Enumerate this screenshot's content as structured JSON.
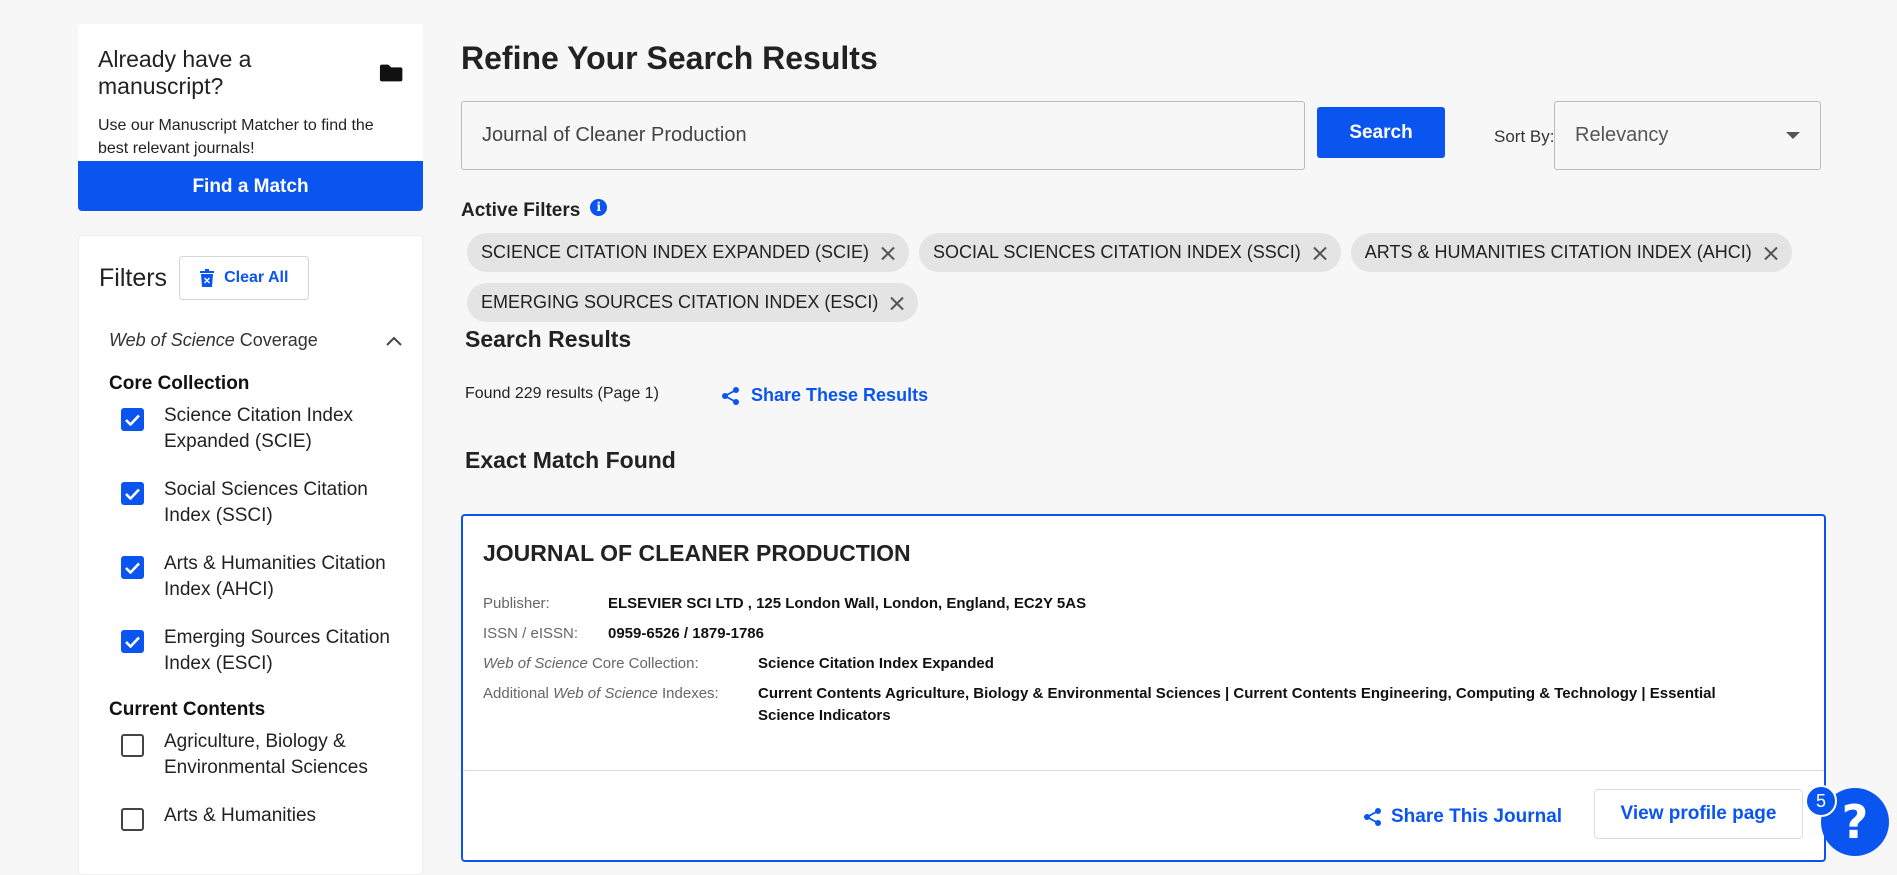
{
  "sidebar": {
    "manuscript": {
      "title": "Already have a manuscript?",
      "description": "Use our Manuscript Matcher to find the best relevant journals!",
      "button": "Find a Match"
    },
    "filters": {
      "title": "Filters",
      "clear_all": "Clear All",
      "coverage_italic": "Web of Science",
      "coverage_rest": " Coverage",
      "core_title": "Core Collection",
      "core_items": [
        {
          "label": "Science Citation Index Expanded (SCIE)",
          "checked": true
        },
        {
          "label": "Social Sciences Citation Index (SSCI)",
          "checked": true
        },
        {
          "label": "Arts & Humanities Citation Index (AHCI)",
          "checked": true
        },
        {
          "label": "Emerging Sources Citation Index (ESCI)",
          "checked": true
        }
      ],
      "current_title": "Current Contents",
      "current_items": [
        {
          "label": "Agriculture, Biology & Environmental Sciences",
          "checked": false
        },
        {
          "label": "Arts & Humanities",
          "checked": false
        }
      ]
    }
  },
  "main": {
    "title": "Refine Your Search Results",
    "search": {
      "value": "Journal of Cleaner Production",
      "button": "Search"
    },
    "sort": {
      "label": "Sort By:",
      "value": "Relevancy"
    },
    "active_filters": {
      "label": "Active Filters",
      "chips": [
        "SCIENCE CITATION INDEX EXPANDED (SCIE)",
        "SOCIAL SCIENCES CITATION INDEX (SSCI)",
        "ARTS & HUMANITIES CITATION INDEX (AHCI)",
        "EMERGING SOURCES CITATION INDEX (ESCI)"
      ]
    },
    "results": {
      "title": "Search Results",
      "count": "Found 229 results (Page 1)",
      "share": "Share These Results",
      "exact_title": "Exact Match Found"
    },
    "journal": {
      "title": "JOURNAL OF CLEANER PRODUCTION",
      "publisher_label": "Publisher:",
      "publisher": "ELSEVIER SCI LTD , 125 London Wall, London, England, EC2Y 5AS",
      "issn_label": "ISSN / eISSN:",
      "issn": "0959-6526 / 1879-1786",
      "core_label_italic": "Web of Science",
      "core_label_rest": " Core Collection:",
      "core": "Science Citation Index Expanded",
      "additional_label_pre": "Additional ",
      "additional_label_italic": "Web of Science",
      "additional_label_rest": " Indexes:",
      "additional": "Current Contents Agriculture, Biology & Environmental Sciences | Current Contents Engineering, Computing & Technology | Essential Science Indicators",
      "share": "Share This Journal",
      "view_profile": "View profile page"
    }
  },
  "help": {
    "icon": "?",
    "badge": "5"
  },
  "colors": {
    "accent": "#0a55f0",
    "chip_bg": "#e4e4e4",
    "page_bg": "#f7f7f7"
  }
}
